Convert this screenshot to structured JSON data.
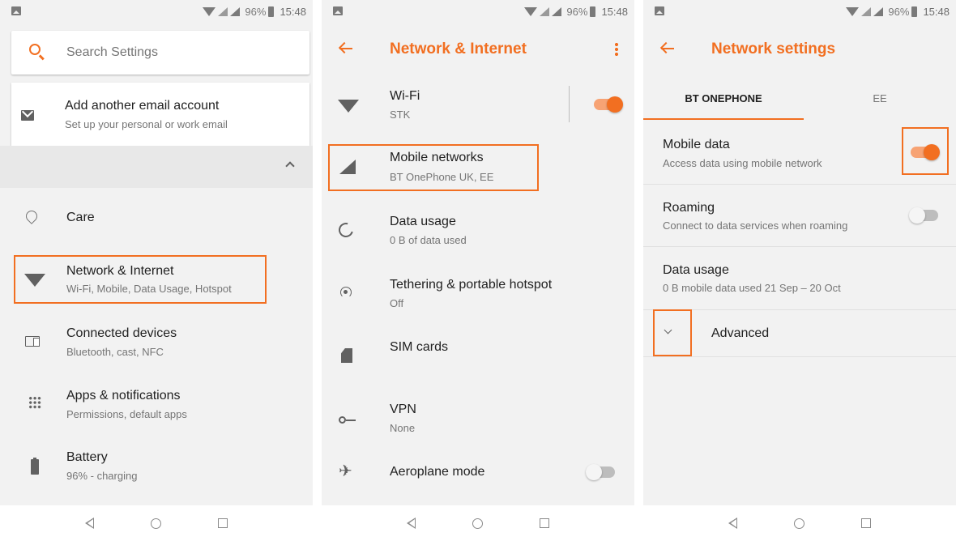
{
  "status_bar": {
    "battery": "96%",
    "time": "15:48"
  },
  "panel1": {
    "search_placeholder": "Search Settings",
    "suggestion": {
      "title": "Add another email account",
      "subtitle": "Set up your personal or work email"
    },
    "items": [
      {
        "title": "Care",
        "subtitle": "",
        "icon": "care-heart-icon"
      },
      {
        "title": "Network & Internet",
        "subtitle": "Wi-Fi, Mobile, Data Usage, Hotspot",
        "icon": "wifi-icon"
      },
      {
        "title": "Connected devices",
        "subtitle": "Bluetooth, cast, NFC",
        "icon": "devices-icon"
      },
      {
        "title": "Apps & notifications",
        "subtitle": "Permissions, default apps",
        "icon": "apps-grid-icon"
      },
      {
        "title": "Battery",
        "subtitle": "96% - charging",
        "icon": "battery-icon"
      }
    ]
  },
  "panel2": {
    "title": "Network & Internet",
    "items": [
      {
        "title": "Wi-Fi",
        "subtitle": "STK",
        "toggle": true
      },
      {
        "title": "Mobile networks",
        "subtitle": "BT OnePhone UK, EE"
      },
      {
        "title": "Data usage",
        "subtitle": "0 B of data used"
      },
      {
        "title": "Tethering & portable hotspot",
        "subtitle": "Off"
      },
      {
        "title": "SIM cards",
        "subtitle": ""
      },
      {
        "title": "VPN",
        "subtitle": "None"
      },
      {
        "title": "Aeroplane mode",
        "subtitle": "",
        "toggle": false
      }
    ]
  },
  "panel3": {
    "title": "Network settings",
    "tabs": [
      "BT ONEPHONE",
      "EE"
    ],
    "items": [
      {
        "title": "Mobile data",
        "subtitle": "Access data using mobile network",
        "toggle": true
      },
      {
        "title": "Roaming",
        "subtitle": "Connect to data services when roaming",
        "toggle": false
      },
      {
        "title": "Data usage",
        "subtitle": "0 B mobile data used 21 Sep – 20 Oct"
      }
    ],
    "advanced": "Advanced"
  },
  "colors": {
    "accent": "#f26f21",
    "highlight": "#f26f21",
    "background": "#f2f2f2"
  }
}
